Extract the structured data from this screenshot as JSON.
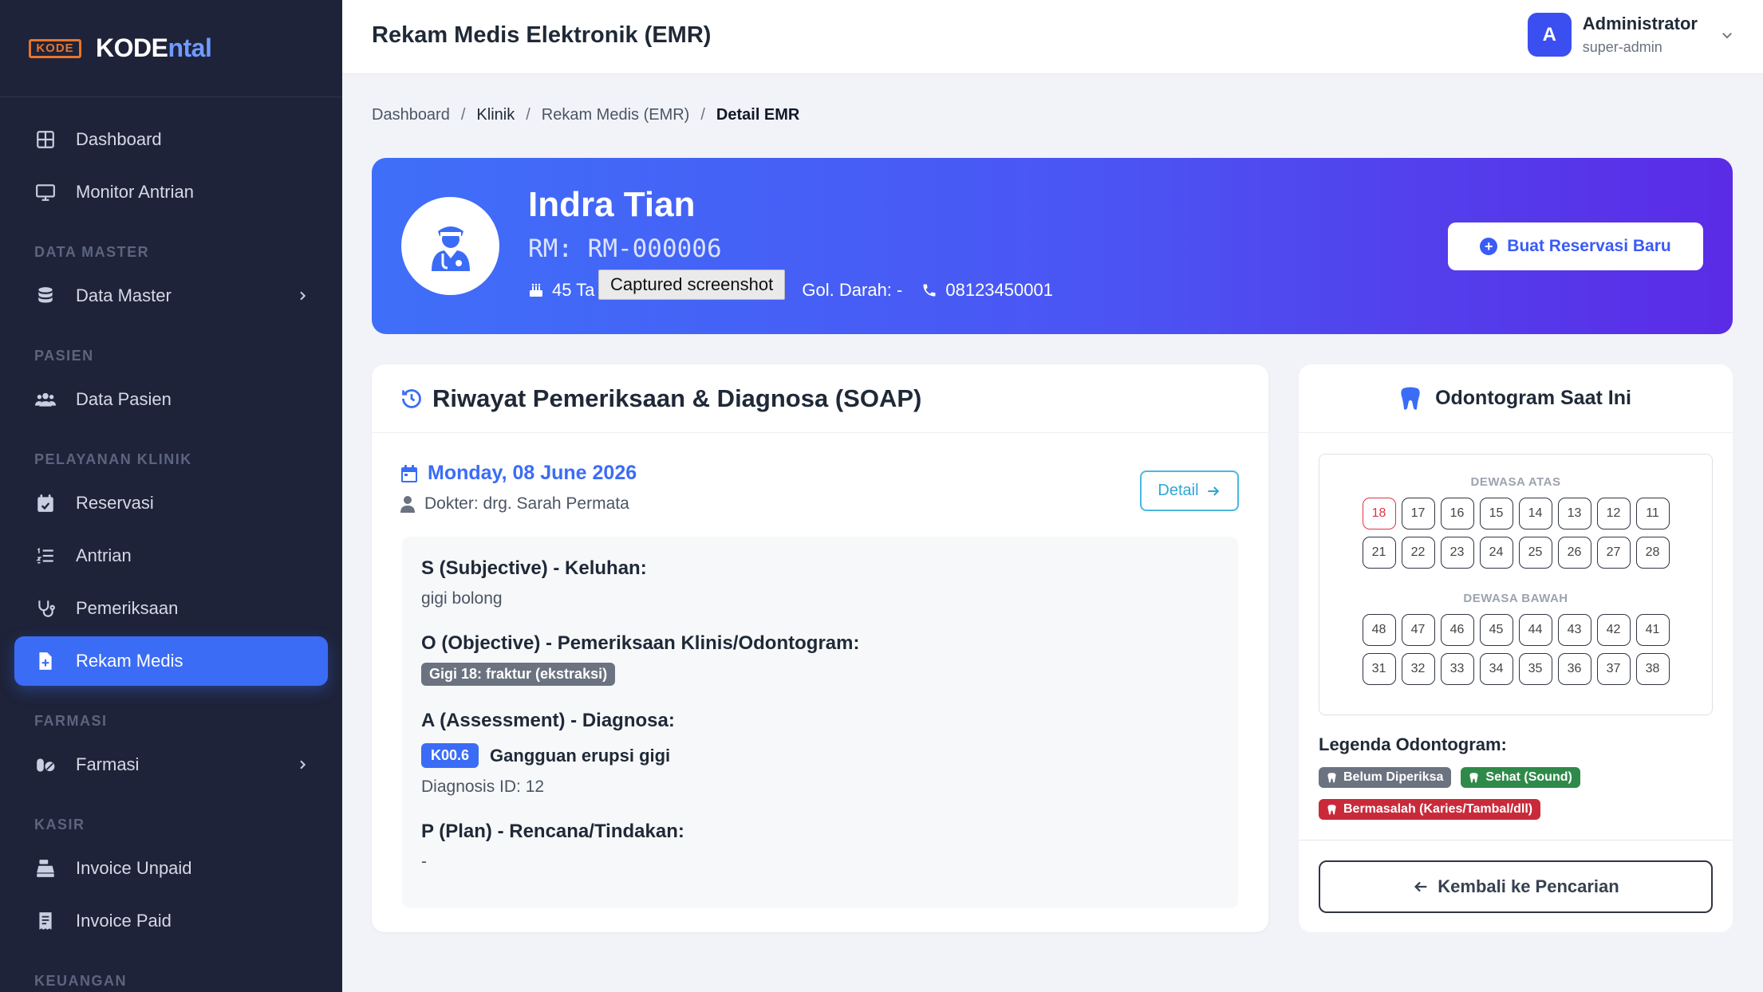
{
  "brand": {
    "logo_text": "KODE",
    "name_main": "KODE",
    "name_accent": "ntal"
  },
  "sidebar": {
    "items": [
      {
        "type": "item",
        "label": "Dashboard",
        "icon": "grid-icon"
      },
      {
        "type": "item",
        "label": "Monitor Antrian",
        "icon": "monitor-icon"
      },
      {
        "type": "section",
        "label": "DATA MASTER"
      },
      {
        "type": "item",
        "label": "Data Master",
        "icon": "database-icon",
        "chevron": true
      },
      {
        "type": "section",
        "label": "PASIEN"
      },
      {
        "type": "item",
        "label": "Data Pasien",
        "icon": "users-icon"
      },
      {
        "type": "section",
        "label": "PELAYANAN KLINIK"
      },
      {
        "type": "item",
        "label": "Reservasi",
        "icon": "calendar-check-icon"
      },
      {
        "type": "item",
        "label": "Antrian",
        "icon": "list-ol-icon"
      },
      {
        "type": "item",
        "label": "Pemeriksaan",
        "icon": "stethoscope-icon"
      },
      {
        "type": "item",
        "label": "Rekam Medis",
        "icon": "file-medical-icon",
        "active": true
      },
      {
        "type": "section",
        "label": "FARMASI"
      },
      {
        "type": "item",
        "label": "Farmasi",
        "icon": "pills-icon",
        "chevron": true
      },
      {
        "type": "section",
        "label": "KASIR"
      },
      {
        "type": "item",
        "label": "Invoice Unpaid",
        "icon": "cash-register-icon"
      },
      {
        "type": "item",
        "label": "Invoice Paid",
        "icon": "receipt-icon"
      },
      {
        "type": "section",
        "label": "KEUANGAN"
      }
    ]
  },
  "header": {
    "title": "Rekam Medis Elektronik (EMR)"
  },
  "user": {
    "initial": "A",
    "name": "Administrator",
    "role": "super-admin"
  },
  "breadcrumb": {
    "b1": "Dashboard",
    "b2": "Klinik",
    "b3": "Rekam Medis (EMR)",
    "b4": "Detail EMR",
    "sep": "/"
  },
  "patient": {
    "name": "Indra Tian",
    "rm": "RM: RM-000006",
    "age_visible": "45 Ta",
    "blood_visible": "Gol. Darah: -",
    "phone": "08123450001",
    "new_reservation_label": "Buat Reservasi Baru"
  },
  "tooltip": "Captured screenshot",
  "soap": {
    "title": "Riwayat Pemeriksaan & Diagnosa (SOAP)",
    "date": "Monday, 08 June 2026",
    "doctor": "Dokter: drg. Sarah Permata",
    "detail_label": "Detail",
    "s_label": "S (Subjective) - Keluhan:",
    "s_value": "gigi bolong",
    "o_label": "O (Objective) - Pemeriksaan Klinis/Odontogram:",
    "o_chip": "Gigi 18: fraktur (ekstraksi)",
    "a_label": "A (Assessment) - Diagnosa:",
    "a_code": "K00.6",
    "a_name": "Gangguan erupsi gigi",
    "a_id": "Diagnosis ID: 12",
    "p_label": "P (Plan) - Rencana/Tindakan:",
    "p_value": "-"
  },
  "odontogram": {
    "title": "Odontogram Saat Ini",
    "upper_label": "DEWASA ATAS",
    "lower_label": "DEWASA BAWAH",
    "rows": [
      [
        "18",
        "17",
        "16",
        "15",
        "14",
        "13",
        "12",
        "11"
      ],
      [
        "21",
        "22",
        "23",
        "24",
        "25",
        "26",
        "27",
        "28"
      ],
      [
        "48",
        "47",
        "46",
        "45",
        "44",
        "43",
        "42",
        "41"
      ],
      [
        "31",
        "32",
        "33",
        "34",
        "35",
        "36",
        "37",
        "38"
      ]
    ],
    "problem_teeth": [
      "18"
    ],
    "legend_title": "Legenda Odontogram:",
    "legend": {
      "unchecked": "Belum Diperiksa",
      "healthy": "Sehat (Sound)",
      "problem": "Bermasalah (Karies/Tambal/dll)"
    },
    "back_label": "Kembali ke Pencarian"
  },
  "colors": {
    "primary": "#3b6cf6",
    "sidebar": "#1e2339",
    "danger": "#dc3545",
    "success": "#2f8a4a",
    "hero_start": "#3f6ff9",
    "hero_end": "#5b2be6"
  }
}
